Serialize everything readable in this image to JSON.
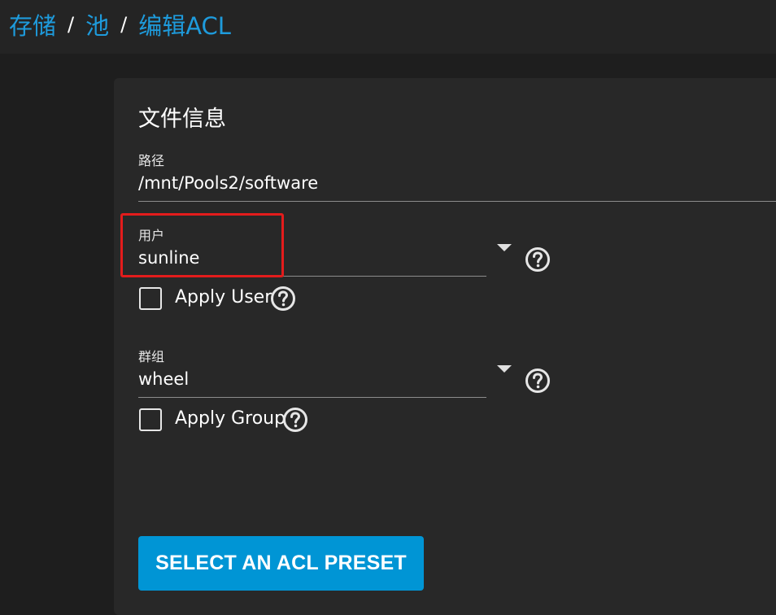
{
  "breadcrumb": {
    "items": [
      "存储",
      "池",
      "编辑ACL"
    ],
    "separator": "/"
  },
  "file_info": {
    "title": "文件信息",
    "path": {
      "label": "路径",
      "value": "/mnt/Pools2/software"
    },
    "user": {
      "label": "用户",
      "value": "sunline",
      "apply_label": "Apply User",
      "apply_checked": false
    },
    "group": {
      "label": "群组",
      "value": "wheel",
      "apply_label": "Apply Group",
      "apply_checked": false
    },
    "preset_button": "SELECT AN ACL PRESET"
  },
  "icons": {
    "help": "help-circle-icon",
    "dropdown": "dropdown-arrow-icon"
  },
  "colors": {
    "accent": "#0095d5",
    "link": "#1e9bdc",
    "highlight": "#e31c1c",
    "background": "#1e1e1e",
    "card": "#282828"
  }
}
